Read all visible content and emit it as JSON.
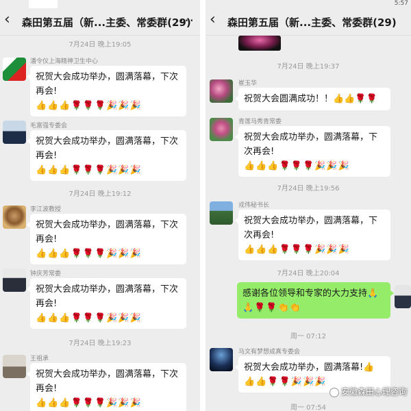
{
  "left_screen": {
    "title": "森田第五届（新...主委、常委群(29)",
    "timestamps": [
      "7月24日 晚上19:05",
      "7月24日 晚上19:12",
      "7月24日 晚上19:23"
    ],
    "messages": [
      {
        "sender": "潘令仪上海精神卫生中心",
        "text": "祝贺大会成功举办，圆满落幕，下次再会!",
        "emojis": [
          "👍",
          "👍",
          "👍",
          "🌹",
          "🌹",
          "🌹",
          "🎉",
          "🎉",
          "🎉"
        ]
      },
      {
        "sender": "毛富强专委会",
        "text": "祝贺大会成功举办，圆满落幕，下次再会!",
        "emojis": [
          "👍",
          "👍",
          "👍",
          "🌹",
          "🌹",
          "🌹",
          "🎉",
          "🎉",
          "🎉"
        ]
      },
      {
        "sender": "李江波教授",
        "text": "祝贺大会成功举办，圆满落幕，下次再会!",
        "emojis": [
          "👍",
          "👍",
          "👍",
          "🌹",
          "🌹",
          "🌹",
          "🎉",
          "🎉",
          "🎉"
        ]
      },
      {
        "sender": "钟庆芳常委",
        "text": "祝贺大会成功举办，圆满落幕，下次再会!",
        "emojis": [
          "👍",
          "👍",
          "👍",
          "🌹",
          "🌹",
          "🌹",
          "🎉",
          "🎉",
          "🎉"
        ]
      },
      {
        "sender": "王祖承",
        "text": "祝贺大会成功举办，圆满落幕，下次再会!",
        "emojis": [
          "👍",
          "👍",
          "👍",
          "🌹",
          "🌹",
          "🌹",
          "🎉",
          "🎉",
          "🎉"
        ]
      }
    ]
  },
  "right_screen": {
    "title": "森田第五届（新...主委、常委群(29)",
    "status_time": "5:57",
    "timestamps": [
      "7月24日 晚上19:37",
      "7月24日 晚上19:56",
      "7月24日 晚上20:04",
      "周一 07:12",
      "周一 07:54"
    ],
    "messages": [
      {
        "sender": "崔玉华",
        "text": "祝贺大会圆满成功！！",
        "emojis": [
          "👍",
          "👍",
          "🌹",
          "🌹"
        ]
      },
      {
        "sender": "青莲马秀青常委",
        "text": "祝贺大会成功举办，圆满落幕，下次再会!",
        "emojis": [
          "👍",
          "👍",
          "👍",
          "🌹",
          "🌹",
          "🌹",
          "🎉",
          "🎉",
          "🎉"
        ]
      },
      {
        "sender": "戎伟秘书长",
        "text": "祝贺大会成功举办，圆满落幕，下次再会!",
        "emojis": [
          "👍",
          "👍",
          "👍",
          "🌹",
          "🌹",
          "🌹",
          "🎉",
          "🎉",
          "🎉"
        ]
      },
      {
        "sender": "",
        "text": "感谢各位领导和专家的大力支持🙏",
        "emojis": [
          "🙏",
          "🌹",
          "🌹",
          "👏",
          "👏"
        ]
      },
      {
        "sender": "马文有梦想成真专委会",
        "text": "祝贺大会成功举办，圆满落幕!👍",
        "emojis": [
          "👍",
          "👍",
          "🌹",
          "🌹",
          "🎉",
          "🎉",
          "🎉"
        ]
      }
    ]
  },
  "watermark": "安徽森田心理咨询",
  "colors": {
    "chat_bg": "#ededed",
    "bubble": "#ffffff",
    "own_bubble": "#95ec69",
    "meta_text": "#9a9a9a"
  }
}
